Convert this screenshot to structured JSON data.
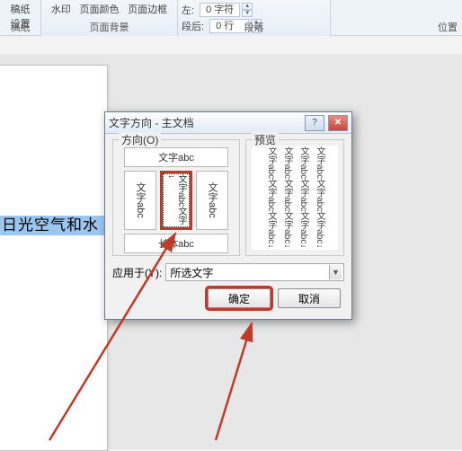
{
  "ribbon": {
    "draft_group": {
      "l1": "稿纸",
      "l2": "设置",
      "label": "稿纸"
    },
    "pagebg_group": {
      "watermark": "水印",
      "pagecolor": "页面颜色",
      "pageborder": "页面边框",
      "label": "页面背景"
    },
    "paragraph_group": {
      "indent_left_label": "左:",
      "indent_left_value": "0 字符",
      "spacing_after_label": "段后:",
      "spacing_after_value": "0 行",
      "label": "段落"
    },
    "position_group": {
      "label": "位置"
    }
  },
  "document": {
    "highlight_text": "日光空气和水"
  },
  "dialog": {
    "title": "文字方向 - 主文档",
    "help": "?",
    "orientation_label": "方向(O)",
    "preview_label": "预览",
    "opt_horizontal": "文字abc",
    "opt_vert1": "文字abc",
    "opt_vert2": "文字abc文字↓",
    "opt_vert3": "文字abc",
    "opt_bottom": "长体abc",
    "preview_text": "文字abc文字abc文字abc↓",
    "apply_label": "应用于(Y):",
    "apply_value": "所选文字",
    "ok": "确定",
    "cancel": "取消"
  }
}
